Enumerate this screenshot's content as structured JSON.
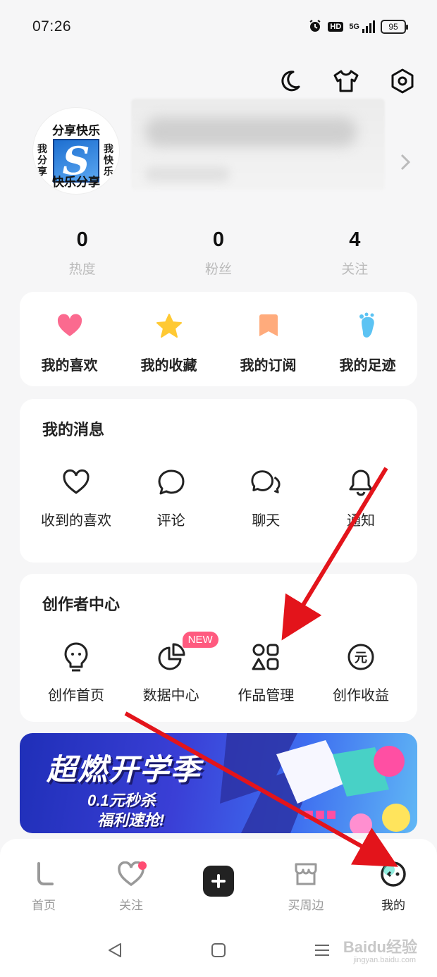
{
  "status_bar": {
    "time": "07:26",
    "hd": "HD",
    "network": "5G",
    "battery": "95"
  },
  "top_actions": {
    "icons": [
      "moon-icon",
      "shirt-icon",
      "settings-icon"
    ]
  },
  "profile": {
    "avatar": {
      "text_top": "分享快乐",
      "text_bottom": "快乐分享",
      "text_left": "我分享",
      "text_right": "我快乐",
      "logo_letter": "S"
    }
  },
  "stats": [
    {
      "value": "0",
      "label": "热度"
    },
    {
      "value": "0",
      "label": "粉丝"
    },
    {
      "value": "4",
      "label": "关注"
    }
  ],
  "quick_links": [
    {
      "label": "我的喜欢",
      "icon": "heart-icon",
      "color": "#fb6a8f"
    },
    {
      "label": "我的收藏",
      "icon": "star-icon",
      "color": "#ffc933"
    },
    {
      "label": "我的订阅",
      "icon": "bookmark-icon",
      "color": "#ffab7c"
    },
    {
      "label": "我的足迹",
      "icon": "footprint-icon",
      "color": "#5cc3f3"
    }
  ],
  "messages": {
    "title": "我的消息",
    "items": [
      {
        "label": "收到的喜欢",
        "icon": "heart-outline-icon"
      },
      {
        "label": "评论",
        "icon": "comment-icon"
      },
      {
        "label": "聊天",
        "icon": "chat-icon"
      },
      {
        "label": "通知",
        "icon": "bell-icon"
      }
    ]
  },
  "creator": {
    "title": "创作者中心",
    "new_badge": "NEW",
    "items": [
      {
        "label": "创作首页",
        "icon": "bulb-icon"
      },
      {
        "label": "数据中心",
        "icon": "pie-chart-icon"
      },
      {
        "label": "作品管理",
        "icon": "shapes-icon"
      },
      {
        "label": "创作收益",
        "icon": "yuan-icon"
      }
    ]
  },
  "banner": {
    "title": "超燃开学季",
    "line1": "0.1元秒杀",
    "line2": "福利速抢!"
  },
  "tab_bar": {
    "tabs": [
      {
        "label": "首页",
        "icon": "home-icon"
      },
      {
        "label": "关注",
        "icon": "follow-icon"
      },
      {
        "label": "",
        "icon": "plus-icon"
      },
      {
        "label": "买周边",
        "icon": "shop-icon"
      },
      {
        "label": "我的",
        "icon": "me-icon"
      }
    ]
  },
  "watermark": {
    "brand": "Baidu经验",
    "url": "jingyan.baidu.com"
  },
  "colors": {
    "accent_pink": "#ff4d73",
    "arrow_red": "#e3141b"
  }
}
